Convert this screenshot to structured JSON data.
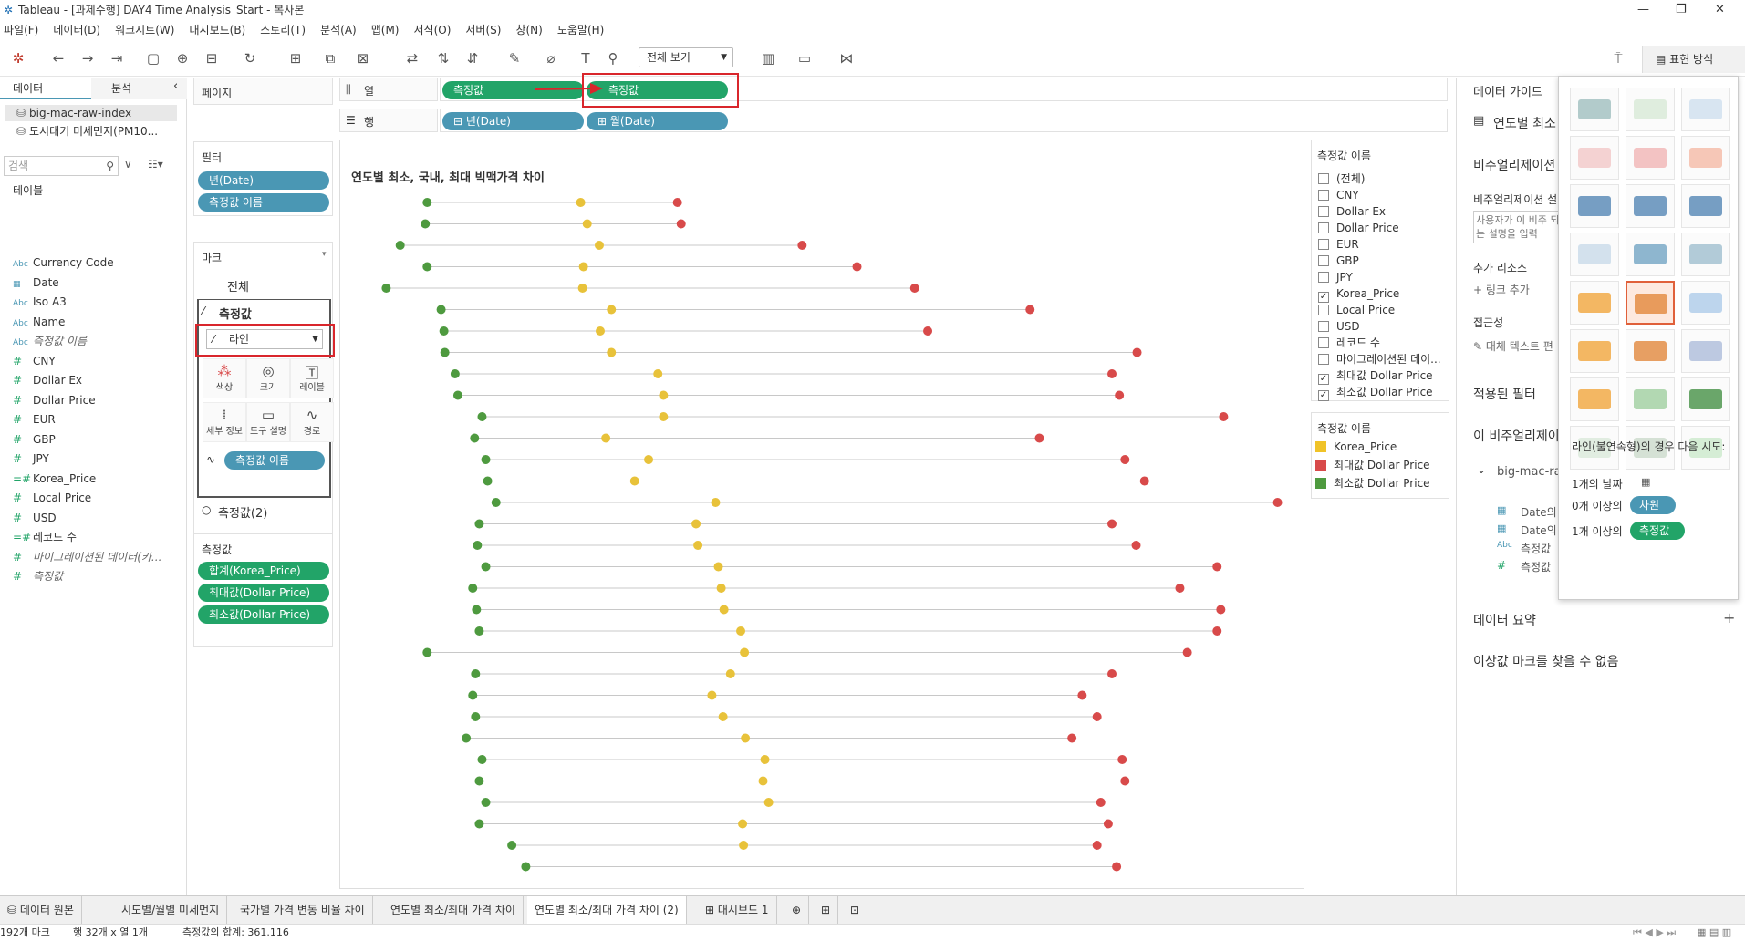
{
  "window": {
    "title": "Tableau - [과제수행] DAY4 Time Analysis_Start - 복사본",
    "min": "—",
    "max": "❐",
    "close": "✕"
  },
  "menu": [
    "파일(F)",
    "데이터(D)",
    "워크시트(W)",
    "대시보드(B)",
    "스토리(T)",
    "분석(A)",
    "맵(M)",
    "서식(O)",
    "서버(S)",
    "창(N)",
    "도움말(H)"
  ],
  "toolbar": {
    "view": "전체 보기",
    "show_me": "표현 방식"
  },
  "data_pane": {
    "tab_data": "데이터",
    "tab_analysis": "분석",
    "sources": [
      "big-mac-raw-index",
      "도시대기 미세먼지(PM10..."
    ],
    "search_placeholder": "검색",
    "tables_header": "테이블",
    "fields": [
      {
        "icon": "Abc",
        "name": "Currency Code"
      },
      {
        "icon": "📅",
        "name": "Date"
      },
      {
        "icon": "Abc",
        "name": "Iso A3"
      },
      {
        "icon": "Abc",
        "name": "Name"
      },
      {
        "icon": "Abc",
        "name": "측정값 이름"
      },
      {
        "icon": "#",
        "name": "CNY"
      },
      {
        "icon": "#",
        "name": "Dollar Ex"
      },
      {
        "icon": "#",
        "name": "Dollar Price"
      },
      {
        "icon": "#",
        "name": "EUR"
      },
      {
        "icon": "#",
        "name": "GBP"
      },
      {
        "icon": "#",
        "name": "JPY"
      },
      {
        "icon": "=#",
        "name": "Korea_Price"
      },
      {
        "icon": "#",
        "name": "Local Price"
      },
      {
        "icon": "#",
        "name": "USD"
      },
      {
        "icon": "=#",
        "name": "레코드 수"
      },
      {
        "icon": "#",
        "name": "마이그레이션된 데이터(카..."
      },
      {
        "icon": "#",
        "name": "측정값"
      }
    ]
  },
  "shelves": {
    "pages": "페이지",
    "filters_label": "필터",
    "filters": [
      "년(Date)",
      "측정값 이름"
    ],
    "marks_label": "마크",
    "marks_all": "전체",
    "marks_measure": "측정값",
    "mark_type": "라인",
    "mark_buttons": [
      "색상",
      "크기",
      "레이블",
      "세부 정보",
      "도구 설명",
      "경로"
    ],
    "marks_pill": "측정값 이름",
    "marks_measure2": "측정값(2)",
    "measures_label": "측정값",
    "measures": [
      "합계(Korea_Price)",
      "최대값(Dollar Price)",
      "최소값(Dollar Price)"
    ],
    "columns_label": "열",
    "columns": [
      "측정값",
      "측정값"
    ],
    "rows_label": "행",
    "rows": [
      "년(Date)",
      "월(Date)"
    ]
  },
  "chart_data": {
    "type": "scatter",
    "title": "연도별 최소, 국내, 최대 빅맥가격 차이",
    "series": [
      {
        "name": "최소값 Dollar Price",
        "color": "#4e9a3f",
        "values": [
          0.64,
          0.62,
          0.35,
          0.64,
          0.2,
          0.79,
          0.82,
          0.83,
          0.94,
          0.97,
          1.23,
          1.15,
          1.27,
          1.29,
          1.38,
          1.2,
          1.18,
          1.27,
          1.13,
          1.17,
          1.2,
          0.64,
          1.16,
          1.13,
          1.16,
          1.06,
          1.23,
          1.2,
          1.27,
          1.2,
          1.55,
          1.7
        ]
      },
      {
        "name": "Korea_Price",
        "color": "#e8c23a",
        "values": [
          2.29,
          2.36,
          2.49,
          2.32,
          2.31,
          2.62,
          2.5,
          2.62,
          3.12,
          3.18,
          3.18,
          2.56,
          3.02,
          2.87,
          3.74,
          3.53,
          3.55,
          3.77,
          3.8,
          3.83,
          4.01,
          4.05,
          3.9,
          3.7,
          3.82,
          4.06,
          4.27,
          4.25,
          4.31,
          4.03,
          4.04
        ],
        "note": "visual"
      },
      {
        "name": "최대값 Dollar Price",
        "color": "#d84a4a",
        "values": [
          3.33,
          3.37,
          4.67,
          5.26,
          5.88,
          7.12,
          6.02,
          8.27,
          8.0,
          8.08,
          9.2,
          7.22,
          8.14,
          8.35,
          9.78,
          8.0,
          8.26,
          9.13,
          8.73,
          9.17,
          9.13,
          8.81,
          8.0,
          7.68,
          7.84,
          7.57,
          8.11,
          8.14,
          7.88,
          7.96,
          7.84,
          8.05
        ]
      }
    ],
    "xlim": [
      0,
      10
    ]
  },
  "legend_filter": {
    "title": "측정값 이름",
    "items": [
      {
        "label": "(전체)",
        "checked": false
      },
      {
        "label": "CNY",
        "checked": false
      },
      {
        "label": "Dollar Ex",
        "checked": false
      },
      {
        "label": "Dollar Price",
        "checked": false
      },
      {
        "label": "EUR",
        "checked": false
      },
      {
        "label": "GBP",
        "checked": false
      },
      {
        "label": "JPY",
        "checked": false
      },
      {
        "label": "Korea_Price",
        "checked": true
      },
      {
        "label": "Local Price",
        "checked": false
      },
      {
        "label": "USD",
        "checked": false
      },
      {
        "label": "레코드 수",
        "checked": false
      },
      {
        "label": "마이그레이션된 데이...",
        "checked": false
      },
      {
        "label": "최대값 Dollar Price",
        "checked": true
      },
      {
        "label": "최소값 Dollar Price",
        "checked": true
      }
    ]
  },
  "color_legend": {
    "title": "측정값 이름",
    "items": [
      {
        "label": "Korea_Price",
        "color": "#f0c328"
      },
      {
        "label": "최대값 Dollar Price",
        "color": "#d84a4a"
      },
      {
        "label": "최소값 Dollar Price",
        "color": "#4e9a3f"
      }
    ]
  },
  "guide": {
    "title": "데이터 가이드",
    "sheet": "연도별 최소",
    "viz_desc": "비주얼리제이션",
    "viz_desc_label": "비주얼리제이션 설",
    "viz_desc_placeholder": "사용자가 이 비주 되는 설명을 입력",
    "resources": "추가 리소스",
    "add_link": "링크 추가",
    "access": "접근성",
    "alt_text": "대체 텍스트 편",
    "applied_filters": "적용된 필터",
    "this_viz": "이 비주얼리제이",
    "source": "big-mac-ra",
    "fields": [
      "Date의",
      "Date의",
      "측정값",
      "측정값"
    ],
    "summary": "데이터 요약",
    "outliers": "이상값 마크를 찾을 수 없음"
  },
  "showme_popup": {
    "hint": "라인(불연속형)의 경우 다음 시도:",
    "req1": "1개의 날짜",
    "req2_prefix": "0개 이상의",
    "req2_pill": "차원",
    "req3_prefix": "1개 이상의",
    "req3_pill": "측정값"
  },
  "tabs": [
    "데이터 원본",
    "시도별/월별 미세먼지",
    "국가별 가격 변동 비율 차이",
    "연도별 최소/최대 가격 차이",
    "연도별 최소/최대 가격 차이 (2)",
    "대시보드 1"
  ],
  "status": {
    "marks": "192개 마크",
    "rows": "행 32개 x 열 1개",
    "sum": "측정값의 합계: 361.116"
  }
}
